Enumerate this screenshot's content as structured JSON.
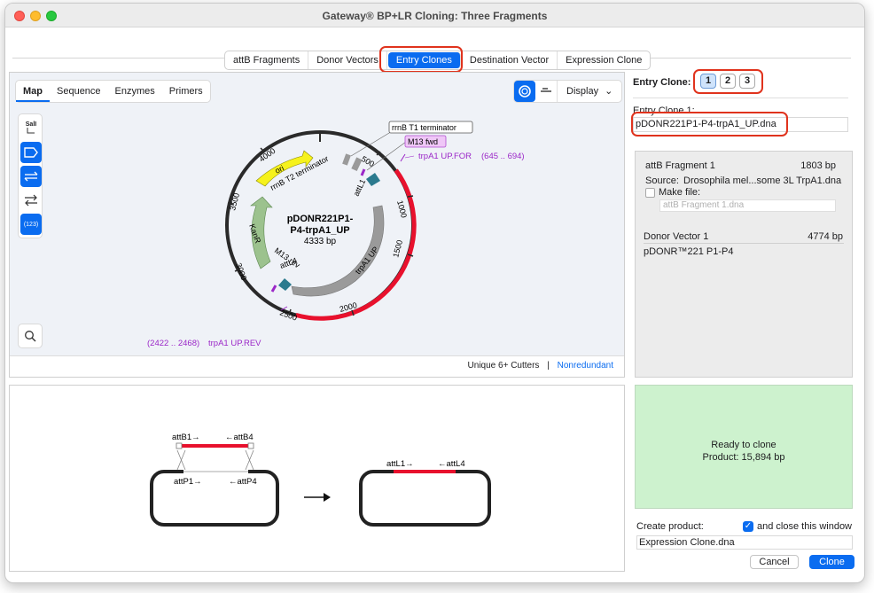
{
  "window": {
    "title": "Gateway® BP+LR Cloning: Three Fragments"
  },
  "steps": {
    "tabs": [
      "attB Fragments",
      "Donor Vectors",
      "Entry Clones",
      "Destination Vector",
      "Expression Clone"
    ],
    "active": "Entry Clones"
  },
  "map_view": {
    "tabs": [
      "Map",
      "Sequence",
      "Enzymes",
      "Primers"
    ],
    "active_tab": "Map",
    "display_label": "Display",
    "tool_sall": "SalI",
    "tool_number": "(123)",
    "cutters_label": "Unique 6+ Cutters",
    "cutters_separator": "|",
    "nonredundant_link": "Nonredundant",
    "plasmid": {
      "name_line1": "pDONR221P1-",
      "name_line2": "P4-trpA1_UP",
      "length": "4333 bp",
      "ticks": [
        "500",
        "1000",
        "1500",
        "2000",
        "2500",
        "3000",
        "3500",
        "4000"
      ],
      "features": {
        "ori": "ori",
        "rrnB_T2": "rrnB T2 terminator",
        "kanR": "KanR",
        "m13rev": "M13 rev",
        "attL4": "attL4",
        "attL1": "attL1",
        "trpA1": "trpA1 UP",
        "rrnB_T1": "rrnB T1 terminator",
        "m13fwd": "M13 fwd"
      },
      "primers": {
        "forward": "trpA1 UP.FOR",
        "forward_range": "(645 .. 694)",
        "reverse": "trpA1 UP.REV",
        "reverse_range": "(2422 .. 2468)"
      }
    }
  },
  "entry_clone": {
    "label": "Entry Clone:",
    "buttons": [
      "1",
      "2",
      "3"
    ],
    "selected": "1",
    "clone1_label": "Entry Clone 1:",
    "clone1_name": "pDONR221P1-P4-trpA1_UP.dna"
  },
  "fragment_panel": {
    "attb_label": "attB Fragment 1",
    "attb_size": "1803 bp",
    "source_label": "Source:",
    "source_value": "Drosophila mel...some 3L TrpA1.dna",
    "make_file_label": "Make file:",
    "make_file_placeholder": "attB Fragment 1.dna",
    "donor_label": "Donor Vector 1",
    "donor_size": "4774 bp",
    "donor_name": "pDONR™221 P1-P4"
  },
  "gateway_diagram": {
    "attB1": "attB1→",
    "attB4": "←attB4",
    "attP1": "attP1→",
    "attP4": "←attP4",
    "attL1": "attL1→",
    "attL4": "←attL4"
  },
  "status": {
    "line1": "Ready to clone",
    "line2": "Product:  15,894 bp"
  },
  "create": {
    "label": "Create product:",
    "close_label": "and close this window",
    "close_checked": true,
    "product_name": "Expression Clone.dna"
  },
  "buttons": {
    "cancel": "Cancel",
    "clone": "Clone"
  },
  "colors": {
    "accent": "#0a6cf0",
    "highlight": "#e0331d",
    "ready": "#cdf2ce",
    "insert": "#e8112d",
    "primer": "#9b27c8"
  }
}
